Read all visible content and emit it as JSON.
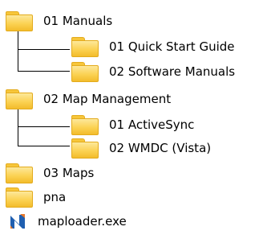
{
  "tree": {
    "items": [
      {
        "label": "01 Manuals",
        "icon": "folder-icon"
      },
      {
        "label": "01 Quick Start Guide",
        "icon": "folder-icon"
      },
      {
        "label": "02 Software Manuals",
        "icon": "folder-icon"
      },
      {
        "label": "02 Map Management",
        "icon": "folder-icon"
      },
      {
        "label": "01 ActiveSync",
        "icon": "folder-icon"
      },
      {
        "label": "02 WMDC (Vista)",
        "icon": "folder-icon"
      },
      {
        "label": "03 Maps",
        "icon": "folder-icon"
      },
      {
        "label": "pna",
        "icon": "folder-icon"
      },
      {
        "label": "maploader.exe",
        "icon": "maploader-app-icon"
      }
    ]
  },
  "colors": {
    "folder_light": "#fde89a",
    "folder_mid": "#fbd253",
    "folder_dark": "#f3bc2c",
    "folder_border": "#e3ab1d",
    "exe_blue": "#1f5fb0",
    "exe_orange": "#e8782a"
  }
}
